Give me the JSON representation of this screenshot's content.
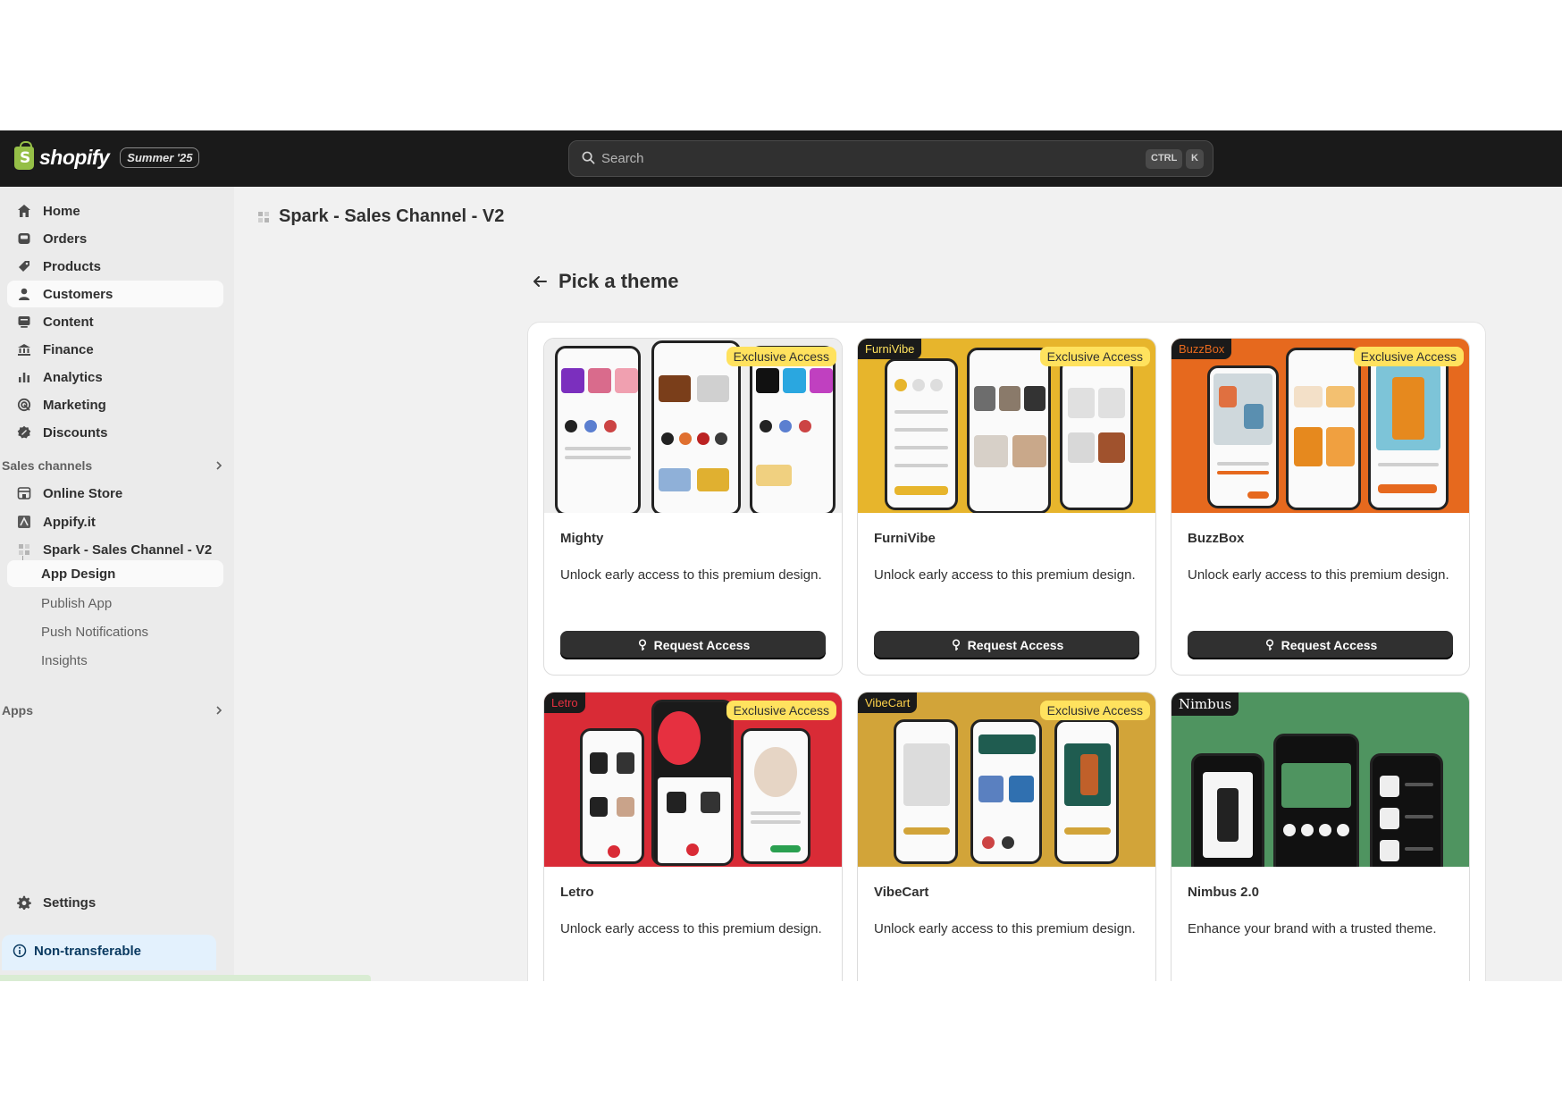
{
  "topbar": {
    "logo_word": "shopify",
    "edition": "Summer '25",
    "search_placeholder": "Search",
    "kbd_ctrl": "CTRL",
    "kbd_k": "K"
  },
  "sidebar": {
    "items": [
      {
        "label": "Home",
        "icon": "home-icon"
      },
      {
        "label": "Orders",
        "icon": "inbox-icon"
      },
      {
        "label": "Products",
        "icon": "tag-icon"
      },
      {
        "label": "Customers",
        "icon": "person-icon"
      },
      {
        "label": "Content",
        "icon": "content-icon"
      },
      {
        "label": "Finance",
        "icon": "bank-icon"
      },
      {
        "label": "Analytics",
        "icon": "bar-chart-icon"
      },
      {
        "label": "Marketing",
        "icon": "target-icon"
      },
      {
        "label": "Discounts",
        "icon": "discount-icon"
      }
    ],
    "sales_channels_label": "Sales channels",
    "channels": [
      {
        "label": "Online Store",
        "icon": "store-icon"
      },
      {
        "label": "Appify.it",
        "icon": "appify-icon"
      },
      {
        "label": "Spark - Sales Channel - V2",
        "icon": "app-icon"
      }
    ],
    "active_sub": "App Design",
    "subitems": [
      "Publish App",
      "Push Notifications",
      "Insights"
    ],
    "apps_label": "Apps",
    "settings_label": "Settings",
    "notice_text": "Non-transferable"
  },
  "main": {
    "page_title": "Spark - Sales Channel - V2",
    "section_title": "Pick a theme"
  },
  "colors": {
    "mighty": "#eeeeee",
    "furnivibe": "#e7b52c",
    "buzzbox": "#e6691e",
    "letro": "#d92b36",
    "vibecart": "#d2a439",
    "nimbus": "#4f9460",
    "badge": "#ffe25e"
  },
  "themes": [
    {
      "name": "Mighty",
      "tag": "",
      "badge": "Exclusive Access",
      "desc": "Unlock early access to this premium design.",
      "button": "Request Access"
    },
    {
      "name": "FurniVibe",
      "tag": "FurniVibe",
      "badge": "Exclusive Access",
      "desc": "Unlock early access to this premium design.",
      "button": "Request Access"
    },
    {
      "name": "BuzzBox",
      "tag": "BuzzBox",
      "badge": "Exclusive Access",
      "desc": "Unlock early access to this premium design.",
      "button": "Request Access"
    },
    {
      "name": "Letro",
      "tag": "Letro",
      "badge": "Exclusive Access",
      "desc": "Unlock early access to this premium design.",
      "button": ""
    },
    {
      "name": "VibeCart",
      "tag": "VibeCart",
      "badge": "Exclusive Access",
      "desc": "Unlock early access to this premium design.",
      "button": ""
    },
    {
      "name": "Nimbus 2.0",
      "tag": "Nimbus",
      "badge": "",
      "desc": "Enhance your brand with a trusted theme.",
      "button": ""
    }
  ]
}
